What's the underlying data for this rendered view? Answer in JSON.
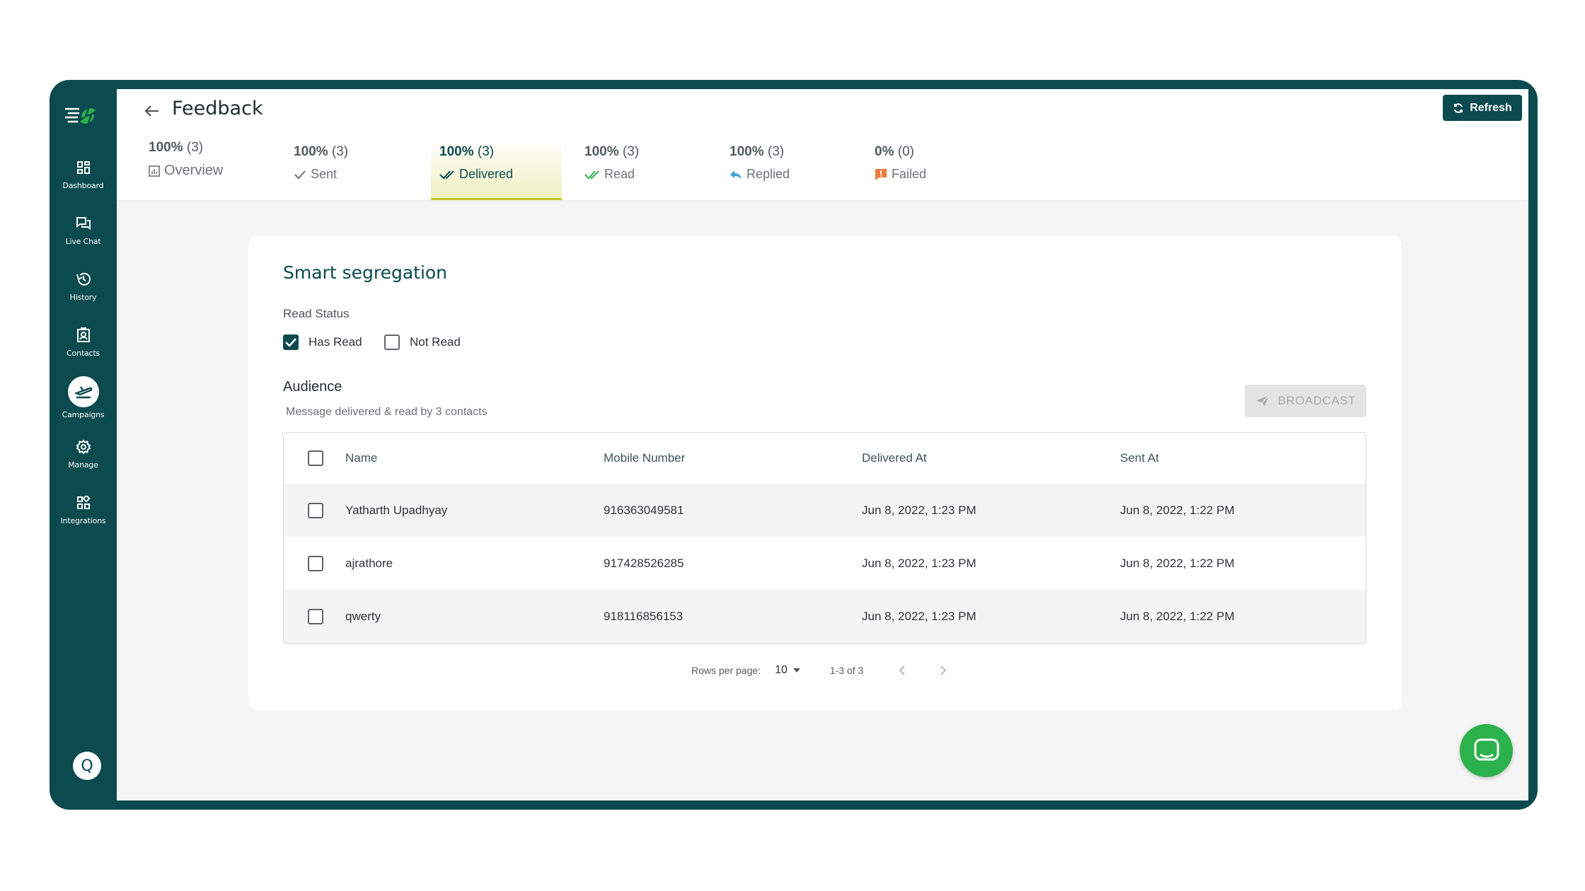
{
  "sidebar": {
    "items": [
      {
        "label": "Dashboard",
        "icon": "grid-icon"
      },
      {
        "label": "Live Chat",
        "icon": "chat-icon"
      },
      {
        "label": "History",
        "icon": "history-icon"
      },
      {
        "label": "Contacts",
        "icon": "contacts-icon"
      },
      {
        "label": "Campaigns",
        "icon": "campaign-icon"
      },
      {
        "label": "Manage",
        "icon": "gear-icon"
      },
      {
        "label": "Integrations",
        "icon": "integrations-icon"
      }
    ],
    "active_index": 4,
    "user_initial": "Q"
  },
  "header": {
    "title": "Feedback",
    "refresh_label": "Refresh"
  },
  "stats": [
    {
      "percent": "100%",
      "count": "(3)",
      "label": "Overview",
      "icon": "chart-icon"
    },
    {
      "percent": "100%",
      "count": "(3)",
      "label": "Sent",
      "icon": "check-icon"
    },
    {
      "percent": "100%",
      "count": "(3)",
      "label": "Delivered",
      "icon": "double-check-icon"
    },
    {
      "percent": "100%",
      "count": "(3)",
      "label": "Read",
      "icon": "double-check-green-icon"
    },
    {
      "percent": "100%",
      "count": "(3)",
      "label": "Replied",
      "icon": "reply-icon"
    },
    {
      "percent": "0%",
      "count": "(0)",
      "label": "Failed",
      "icon": "alert-icon"
    }
  ],
  "segregation": {
    "title": "Smart segregation",
    "read_status_label": "Read Status",
    "has_read_label": "Has Read",
    "has_read_checked": true,
    "not_read_label": "Not Read",
    "not_read_checked": false,
    "audience_title": "Audience",
    "audience_sub": "Message delivered & read by 3 contacts",
    "broadcast_label": "BROADCAST"
  },
  "table": {
    "columns": [
      "Name",
      "Mobile Number",
      "Delivered At",
      "Sent At"
    ],
    "rows": [
      [
        "Yatharth Upadhyay",
        "916363049581",
        "Jun 8, 2022, 1:23 PM",
        "Jun 8, 2022, 1:22 PM"
      ],
      [
        "ajrathore",
        "917428526285",
        "Jun 8, 2022, 1:23 PM",
        "Jun 8, 2022, 1:22 PM"
      ],
      [
        "qwerty",
        "918116856153",
        "Jun 8, 2022, 1:23 PM",
        "Jun 8, 2022, 1:22 PM"
      ]
    ]
  },
  "pagination": {
    "rows_per_page_label": "Rows per page:",
    "rows_per_page": "10",
    "range": "1-3 of 3"
  },
  "colors": {
    "brand": "#0b4a4e",
    "accent_green": "#2bb24c",
    "active_tab_underline": "#c9c82a"
  }
}
